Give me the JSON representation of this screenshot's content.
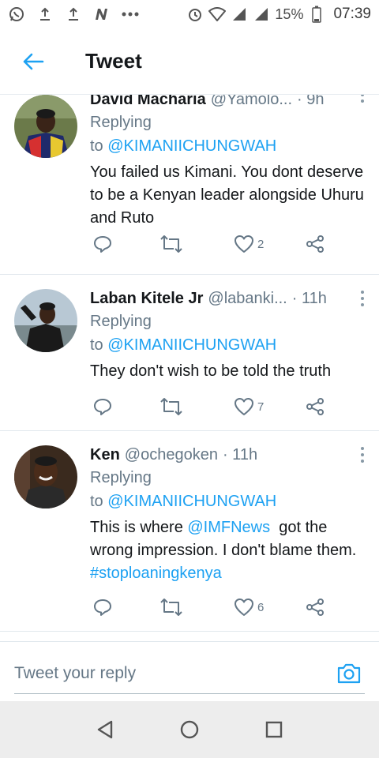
{
  "status_bar": {
    "battery_percent": "15%",
    "time": "07:39",
    "icons": [
      "whatsapp-icon",
      "upload-icon",
      "upload-icon",
      "n-app-icon",
      "more-dots-icon",
      "alarm-icon",
      "wifi-icon",
      "signal-icon",
      "signal-icon",
      "battery-icon"
    ]
  },
  "header": {
    "title": "Tweet",
    "back_icon": "arrow-left-icon"
  },
  "colors": {
    "accent": "#1da1f2",
    "secondary_text": "#657786",
    "primary_text": "#14171a"
  },
  "tweets": [
    {
      "name": "David Macharia",
      "handle": "@Yamolo...",
      "time": "· 9h",
      "replying_label": "Replying",
      "replying_to_prefix": "to ",
      "replying_to": "@KIMANIICHUNGWAH",
      "text": "You failed us Kimani. You dont deserve to be a Kenyan leader alongside Uhuru and Ruto",
      "likes": "2"
    },
    {
      "name": "Laban Kitele Jr",
      "handle": "@labanki...",
      "time": "· 11h",
      "replying_label": "Replying",
      "replying_to_prefix": "to ",
      "replying_to": "@KIMANIICHUNGWAH",
      "text": "They don't wish to be told the truth",
      "likes": "7"
    },
    {
      "name": "Ken",
      "handle": "@ochegoken",
      "time": "· 11h",
      "replying_label": "Replying",
      "replying_to_prefix": "to ",
      "replying_to": "@KIMANIICHUNGWAH",
      "text_part1": "This is where ",
      "text_mention": "@IMFNews",
      "text_part2": "  got the wrong impression. I don't blame them. ",
      "text_hashtag": "#stoploaningkenya",
      "likes": "6"
    }
  ],
  "reply_bar": {
    "placeholder": "Tweet your reply"
  }
}
